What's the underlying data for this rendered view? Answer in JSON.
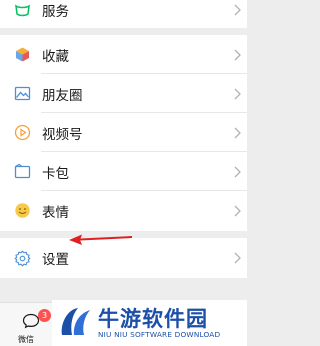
{
  "menu": {
    "services": "服务",
    "favorites": "收藏",
    "moments": "朋友圈",
    "channels": "视频号",
    "cards": "卡包",
    "stickers": "表情",
    "settings": "设置"
  },
  "tabbar": {
    "chats_label": "微信",
    "chats_badge": "3"
  },
  "watermark": {
    "title": "牛游软件园",
    "subtitle": "NIU NIU SOFTWARE DOWNLOAD"
  },
  "colors": {
    "accent_green": "#07c160",
    "arrow_red": "#e02020",
    "watermark_blue": "#1c4fa8"
  }
}
